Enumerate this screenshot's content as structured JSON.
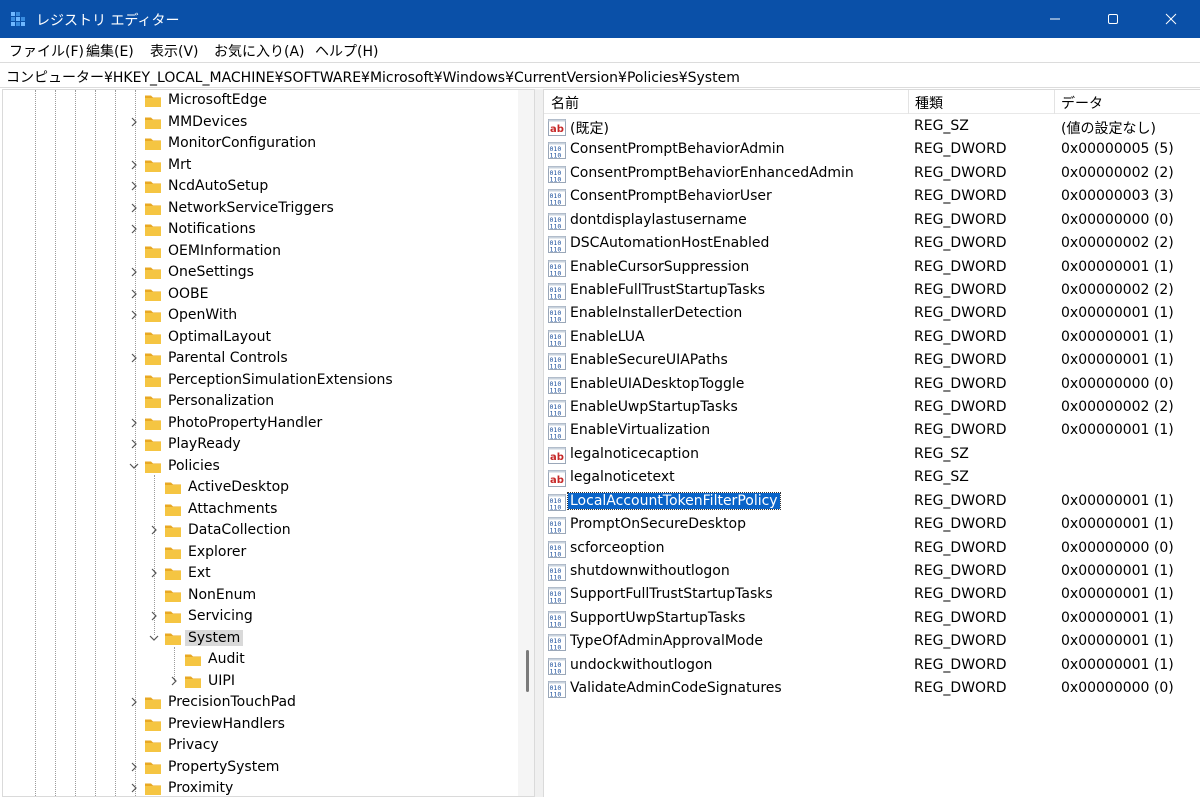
{
  "window": {
    "title": "レジストリ エディター",
    "minimize_icon": "minimize-icon",
    "maximize_icon": "maximize-icon",
    "close_icon": "close-icon",
    "accent": "#0a50a8"
  },
  "menu": [
    {
      "label": "ファイル(F)"
    },
    {
      "label": "編集(E)"
    },
    {
      "label": "表示(V)"
    },
    {
      "label": "お気に入り(A)"
    },
    {
      "label": "ヘルプ(H)"
    }
  ],
  "address": {
    "path": "コンピューター¥HKEY_LOCAL_MACHINE¥SOFTWARE¥Microsoft¥Windows¥CurrentVersion¥Policies¥System"
  },
  "tree": {
    "items": [
      {
        "label": "MicrosoftEdge",
        "level": 0,
        "chevron": "none",
        "selected": false
      },
      {
        "label": "MMDevices",
        "level": 0,
        "chevron": "right",
        "selected": false
      },
      {
        "label": "MonitorConfiguration",
        "level": 0,
        "chevron": "none",
        "selected": false
      },
      {
        "label": "Mrt",
        "level": 0,
        "chevron": "right",
        "selected": false
      },
      {
        "label": "NcdAutoSetup",
        "level": 0,
        "chevron": "right",
        "selected": false
      },
      {
        "label": "NetworkServiceTriggers",
        "level": 0,
        "chevron": "right",
        "selected": false
      },
      {
        "label": "Notifications",
        "level": 0,
        "chevron": "right",
        "selected": false
      },
      {
        "label": "OEMInformation",
        "level": 0,
        "chevron": "none",
        "selected": false
      },
      {
        "label": "OneSettings",
        "level": 0,
        "chevron": "right",
        "selected": false
      },
      {
        "label": "OOBE",
        "level": 0,
        "chevron": "right",
        "selected": false
      },
      {
        "label": "OpenWith",
        "level": 0,
        "chevron": "right",
        "selected": false
      },
      {
        "label": "OptimalLayout",
        "level": 0,
        "chevron": "none",
        "selected": false
      },
      {
        "label": "Parental Controls",
        "level": 0,
        "chevron": "right",
        "selected": false
      },
      {
        "label": "PerceptionSimulationExtensions",
        "level": 0,
        "chevron": "none",
        "selected": false
      },
      {
        "label": "Personalization",
        "level": 0,
        "chevron": "none",
        "selected": false
      },
      {
        "label": "PhotoPropertyHandler",
        "level": 0,
        "chevron": "right",
        "selected": false
      },
      {
        "label": "PlayReady",
        "level": 0,
        "chevron": "right",
        "selected": false
      },
      {
        "label": "Policies",
        "level": 0,
        "chevron": "down",
        "selected": false
      },
      {
        "label": "ActiveDesktop",
        "level": 1,
        "chevron": "none",
        "selected": false
      },
      {
        "label": "Attachments",
        "level": 1,
        "chevron": "none",
        "selected": false
      },
      {
        "label": "DataCollection",
        "level": 1,
        "chevron": "right",
        "selected": false
      },
      {
        "label": "Explorer",
        "level": 1,
        "chevron": "none",
        "selected": false
      },
      {
        "label": "Ext",
        "level": 1,
        "chevron": "right",
        "selected": false
      },
      {
        "label": "NonEnum",
        "level": 1,
        "chevron": "none",
        "selected": false
      },
      {
        "label": "Servicing",
        "level": 1,
        "chevron": "right",
        "selected": false
      },
      {
        "label": "System",
        "level": 1,
        "chevron": "down",
        "selected": true
      },
      {
        "label": "Audit",
        "level": 2,
        "chevron": "none",
        "selected": false
      },
      {
        "label": "UIPI",
        "level": 2,
        "chevron": "right",
        "selected": false
      },
      {
        "label": "PrecisionTouchPad",
        "level": 0,
        "chevron": "right",
        "selected": false
      },
      {
        "label": "PreviewHandlers",
        "level": 0,
        "chevron": "none",
        "selected": false
      },
      {
        "label": "Privacy",
        "level": 0,
        "chevron": "none",
        "selected": false
      },
      {
        "label": "PropertySystem",
        "level": 0,
        "chevron": "right",
        "selected": false
      },
      {
        "label": "Proximity",
        "level": 0,
        "chevron": "right",
        "selected": false
      }
    ],
    "folder_icon": "folder-icon",
    "folder_color": "#f5c542"
  },
  "values": {
    "columns": [
      "名前",
      "種類",
      "データ"
    ],
    "rows": [
      {
        "name": "(既定)",
        "type": "REG_SZ",
        "data": "(値の設定なし)",
        "icon": "string-value-icon",
        "selected": false
      },
      {
        "name": "ConsentPromptBehaviorAdmin",
        "type": "REG_DWORD",
        "data": "0x00000005 (5)",
        "icon": "binary-value-icon",
        "selected": false
      },
      {
        "name": "ConsentPromptBehaviorEnhancedAdmin",
        "type": "REG_DWORD",
        "data": "0x00000002 (2)",
        "icon": "binary-value-icon",
        "selected": false
      },
      {
        "name": "ConsentPromptBehaviorUser",
        "type": "REG_DWORD",
        "data": "0x00000003 (3)",
        "icon": "binary-value-icon",
        "selected": false
      },
      {
        "name": "dontdisplaylastusername",
        "type": "REG_DWORD",
        "data": "0x00000000 (0)",
        "icon": "binary-value-icon",
        "selected": false
      },
      {
        "name": "DSCAutomationHostEnabled",
        "type": "REG_DWORD",
        "data": "0x00000002 (2)",
        "icon": "binary-value-icon",
        "selected": false
      },
      {
        "name": "EnableCursorSuppression",
        "type": "REG_DWORD",
        "data": "0x00000001 (1)",
        "icon": "binary-value-icon",
        "selected": false
      },
      {
        "name": "EnableFullTrustStartupTasks",
        "type": "REG_DWORD",
        "data": "0x00000002 (2)",
        "icon": "binary-value-icon",
        "selected": false
      },
      {
        "name": "EnableInstallerDetection",
        "type": "REG_DWORD",
        "data": "0x00000001 (1)",
        "icon": "binary-value-icon",
        "selected": false
      },
      {
        "name": "EnableLUA",
        "type": "REG_DWORD",
        "data": "0x00000001 (1)",
        "icon": "binary-value-icon",
        "selected": false
      },
      {
        "name": "EnableSecureUIAPaths",
        "type": "REG_DWORD",
        "data": "0x00000001 (1)",
        "icon": "binary-value-icon",
        "selected": false
      },
      {
        "name": "EnableUIADesktopToggle",
        "type": "REG_DWORD",
        "data": "0x00000000 (0)",
        "icon": "binary-value-icon",
        "selected": false
      },
      {
        "name": "EnableUwpStartupTasks",
        "type": "REG_DWORD",
        "data": "0x00000002 (2)",
        "icon": "binary-value-icon",
        "selected": false
      },
      {
        "name": "EnableVirtualization",
        "type": "REG_DWORD",
        "data": "0x00000001 (1)",
        "icon": "binary-value-icon",
        "selected": false
      },
      {
        "name": "legalnoticecaption",
        "type": "REG_SZ",
        "data": "",
        "icon": "string-value-icon",
        "selected": false
      },
      {
        "name": "legalnoticetext",
        "type": "REG_SZ",
        "data": "",
        "icon": "string-value-icon",
        "selected": false
      },
      {
        "name": "LocalAccountTokenFilterPolicy",
        "type": "REG_DWORD",
        "data": "0x00000001 (1)",
        "icon": "binary-value-icon",
        "selected": true
      },
      {
        "name": "PromptOnSecureDesktop",
        "type": "REG_DWORD",
        "data": "0x00000001 (1)",
        "icon": "binary-value-icon",
        "selected": false
      },
      {
        "name": "scforceoption",
        "type": "REG_DWORD",
        "data": "0x00000000 (0)",
        "icon": "binary-value-icon",
        "selected": false
      },
      {
        "name": "shutdownwithoutlogon",
        "type": "REG_DWORD",
        "data": "0x00000001 (1)",
        "icon": "binary-value-icon",
        "selected": false
      },
      {
        "name": "SupportFullTrustStartupTasks",
        "type": "REG_DWORD",
        "data": "0x00000001 (1)",
        "icon": "binary-value-icon",
        "selected": false
      },
      {
        "name": "SupportUwpStartupTasks",
        "type": "REG_DWORD",
        "data": "0x00000001 (1)",
        "icon": "binary-value-icon",
        "selected": false
      },
      {
        "name": "TypeOfAdminApprovalMode",
        "type": "REG_DWORD",
        "data": "0x00000001 (1)",
        "icon": "binary-value-icon",
        "selected": false
      },
      {
        "name": "undockwithoutlogon",
        "type": "REG_DWORD",
        "data": "0x00000001 (1)",
        "icon": "binary-value-icon",
        "selected": false
      },
      {
        "name": "ValidateAdminCodeSignatures",
        "type": "REG_DWORD",
        "data": "0x00000000 (0)",
        "icon": "binary-value-icon",
        "selected": false
      }
    ],
    "selection_color": "#0a64c8"
  }
}
